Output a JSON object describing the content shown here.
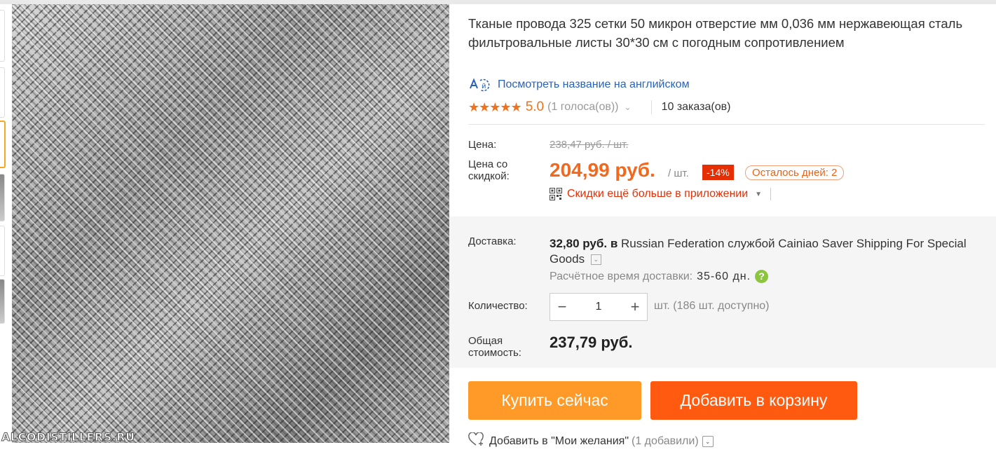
{
  "product": {
    "title": "Тканые провода 325 сетки 50 микрон отверстие мм 0,036 мм нержавеющая сталь фильтровальные листы 30*30 см с погодным сопротивлением",
    "translate_link": "Посмотреть название на английском",
    "translate_icon": "translate-icon",
    "rating": {
      "stars": "★★★★★",
      "score": "5.0",
      "votes": "(1 голоса(ов))",
      "orders": "10 заказа(ов)"
    }
  },
  "price": {
    "label": "Цена:",
    "old": "238,47 руб. / шт.",
    "discount_label_line1": "Цена со",
    "discount_label_line2": "скидкой:",
    "new": "204,99 руб.",
    "unit": "/ шт.",
    "discount_badge": "-14%",
    "days_left": "Осталось дней: 2",
    "app_promo": "Скидки ещё больше в приложении"
  },
  "delivery": {
    "label": "Доставка:",
    "cost": "32,80 руб. в",
    "destination": "Russian Federation службой Cainiao Saver Shipping For Special Goods",
    "eta_label": "Расчётное время доставки:",
    "eta_value": "35-60 дн."
  },
  "quantity": {
    "label": "Количество:",
    "value": "1",
    "minus": "−",
    "plus": "+",
    "available": "шт. (186 шт. доступно)"
  },
  "total": {
    "label_line1": "Общая",
    "label_line2": "стоимость:",
    "value": "237,79 руб."
  },
  "actions": {
    "buy_now": "Купить сейчас",
    "add_to_cart": "Добавить в корзину",
    "wishlist": "Добавить в \"Мои желания\"",
    "wishlist_count": "(1 добавили)"
  },
  "image": {
    "watermark": "ALCODISTILLERS.RU"
  },
  "colors": {
    "price_orange": "#f2681c",
    "buy_button": "#ff9a28",
    "cart_button": "#ff5a10",
    "discount_badge": "#e62e04",
    "link_blue": "#2a62b8"
  }
}
